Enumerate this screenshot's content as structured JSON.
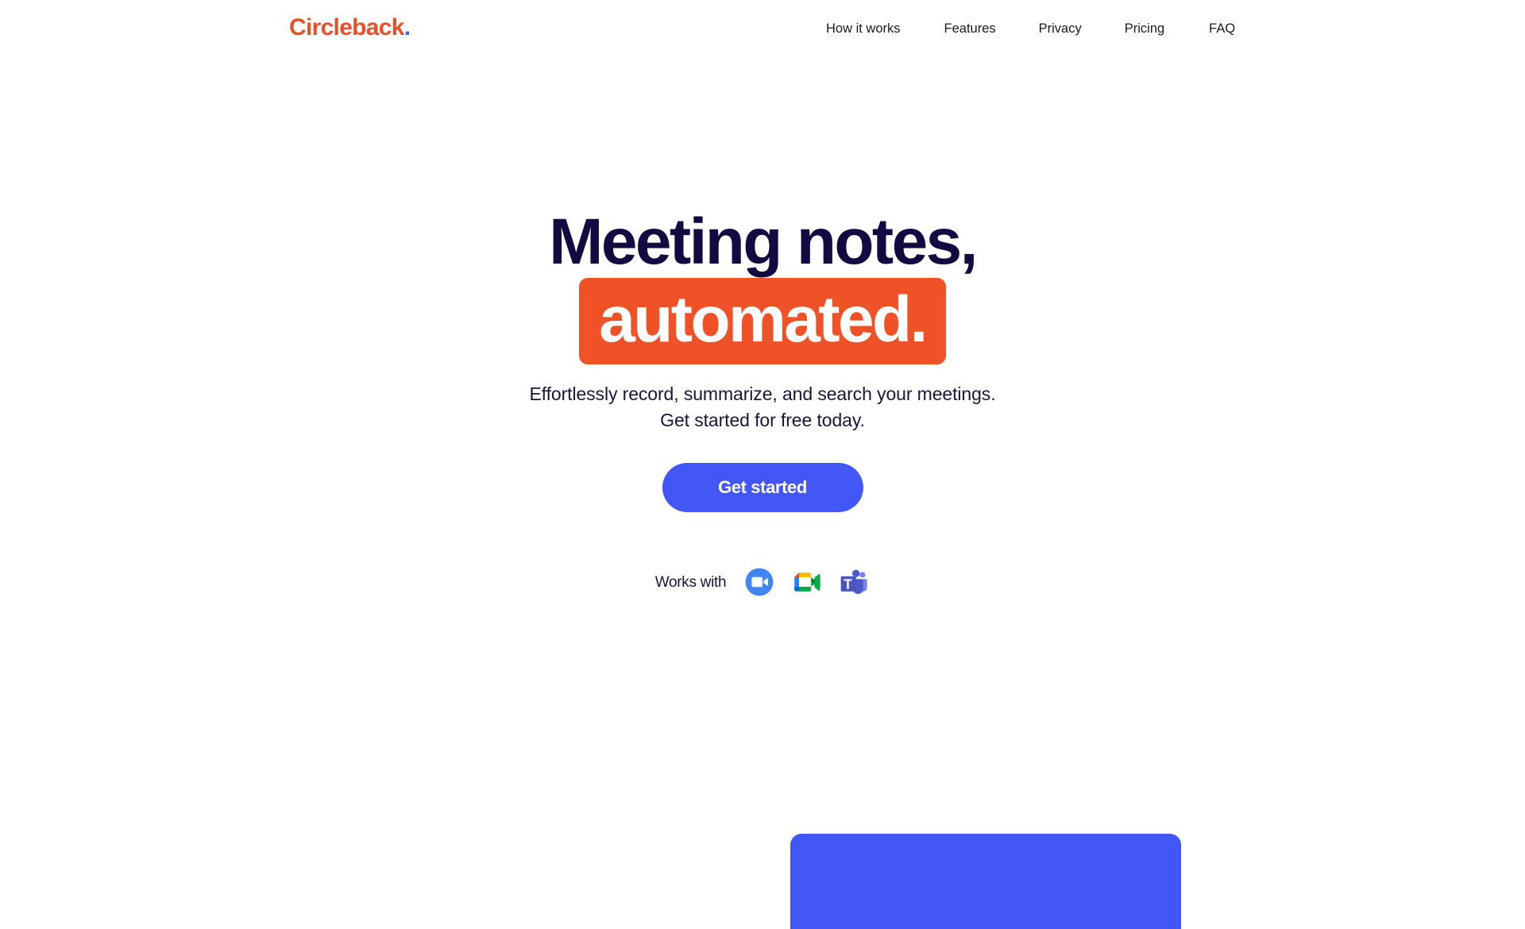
{
  "header": {
    "brand": {
      "name": "Circleback",
      "dot": ".",
      "color": "#E8502A",
      "dot_color": "#3D5AF1"
    },
    "nav": [
      {
        "label": "How it works"
      },
      {
        "label": "Features"
      },
      {
        "label": "Privacy"
      },
      {
        "label": "Pricing"
      },
      {
        "label": "FAQ"
      }
    ]
  },
  "hero": {
    "headline_line1": "Meeting notes,",
    "headline_line2": "automated.",
    "headline_color": "#110B41",
    "highlight_bg": "#F05228",
    "highlight_text_color": "#FFFFFF",
    "subtitle_line1": "Effortlessly record, summarize, and search your meetings.",
    "subtitle_line2": "Get started for free today.",
    "cta_label": "Get started",
    "cta_color": "#4356F6"
  },
  "works_with": {
    "label": "Works with",
    "apps": [
      {
        "name": "Zoom",
        "icon": "zoom-icon"
      },
      {
        "name": "Google Meet",
        "icon": "google-meet-icon"
      },
      {
        "name": "Microsoft Teams",
        "icon": "microsoft-teams-icon"
      }
    ]
  },
  "bottom_panel": {
    "color": "#4356F6"
  }
}
